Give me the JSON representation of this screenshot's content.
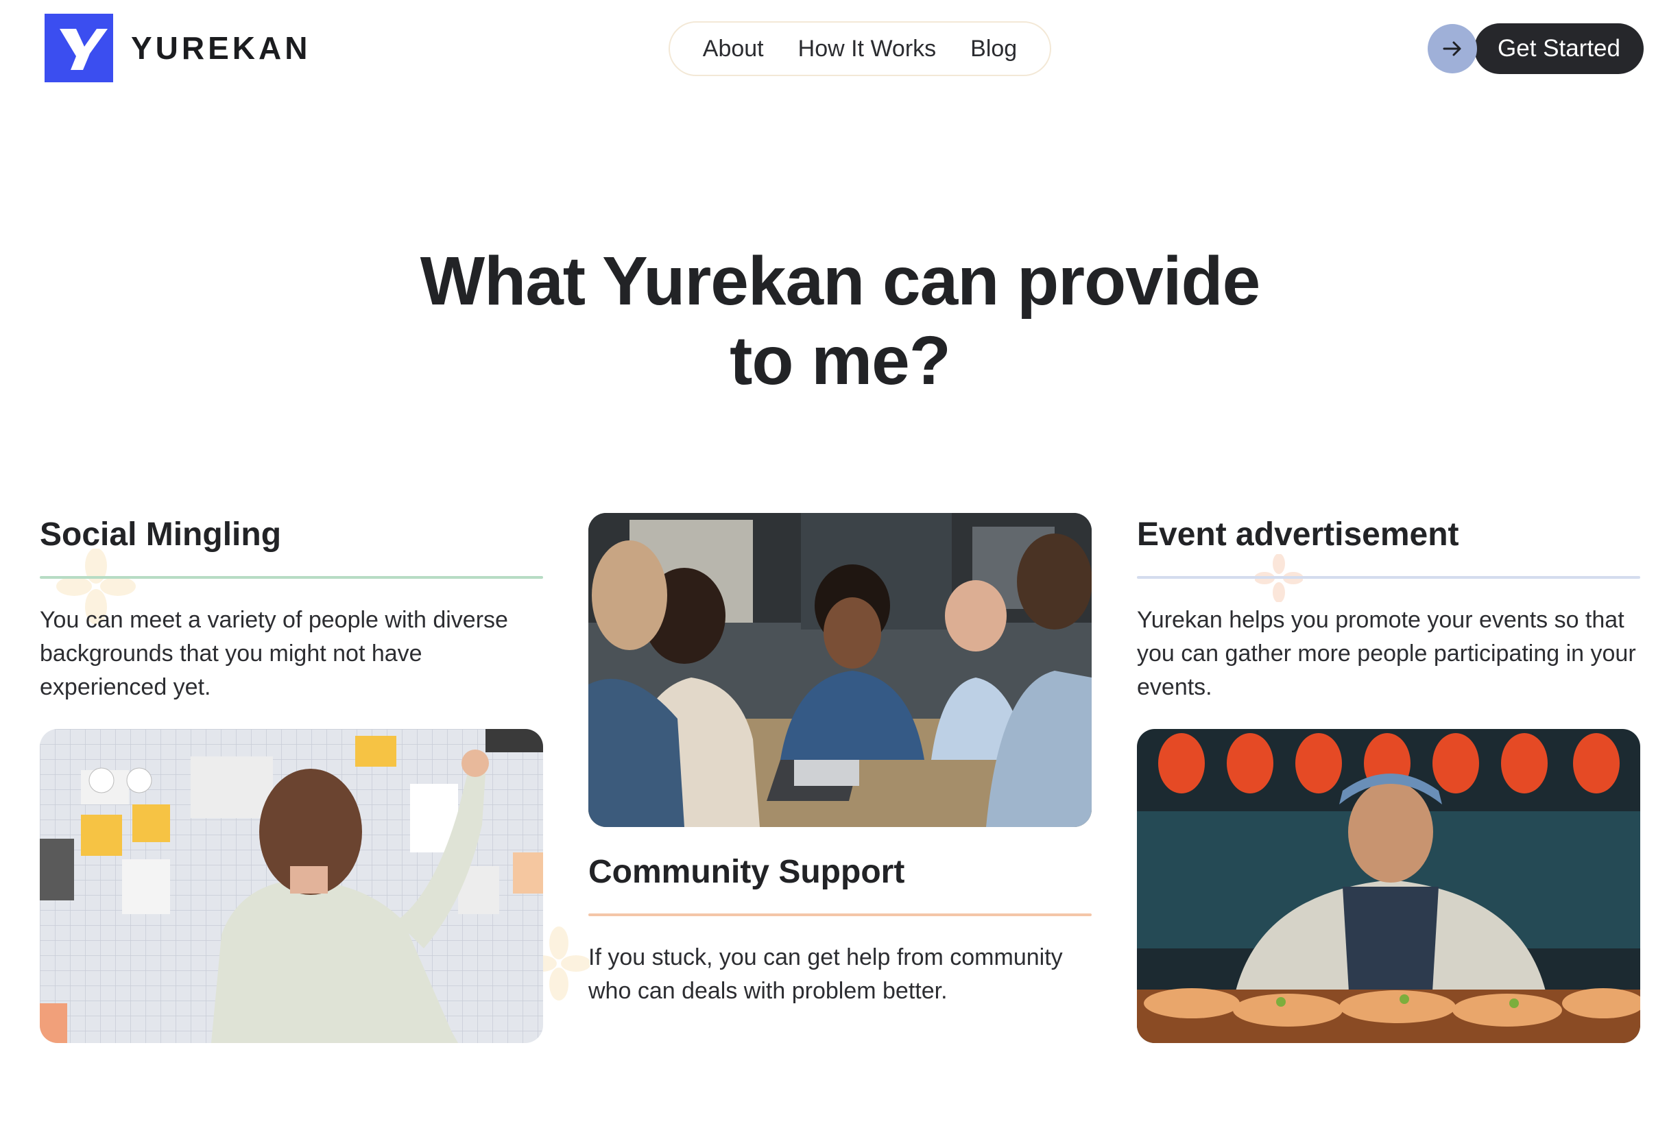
{
  "brand": {
    "name": "YUREKAN",
    "logo_color": "#3b4ef0"
  },
  "nav": {
    "links": [
      "About",
      "How It Works",
      "Blog"
    ]
  },
  "cta": {
    "label": "Get Started",
    "arrow_icon": "arrow-right-icon"
  },
  "hero": {
    "line1": "What Yurekan can provide",
    "line2": "to me?"
  },
  "cards": {
    "social": {
      "title": "Social Mingling",
      "text": "You can meet a variety of people with diverse backgrounds that you might not have experienced yet.",
      "divider_color": "#b7dcc4"
    },
    "community": {
      "title": "Community Support",
      "text": "If you stuck, you can get help from community who can deals with problem better.",
      "divider_color": "#f4c6a8"
    },
    "event": {
      "title": "Event advertisement",
      "text": "Yurekan helps you promote your events so that you can gather more people participating in your events.",
      "divider_color": "#d4dcee"
    }
  },
  "colors": {
    "dark": "#26272b",
    "arrow_circle": "#9fb0d8",
    "nav_border": "#f3e8d6"
  }
}
